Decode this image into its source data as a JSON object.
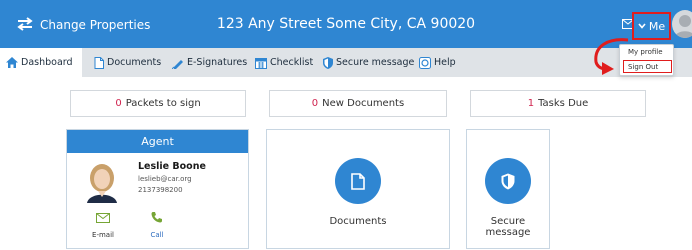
{
  "header": {
    "app_title": "Change Properties",
    "address": "123 Any Street Some City, CA 90020",
    "me_label": "Me"
  },
  "user_menu": {
    "items": [
      "My profile",
      "Sign Out"
    ]
  },
  "nav": {
    "tabs": [
      {
        "label": "Dashboard",
        "icon": "home-icon",
        "active": true
      },
      {
        "label": "Documents",
        "icon": "document-icon"
      },
      {
        "label": "E-Signatures",
        "icon": "pen-icon"
      },
      {
        "label": "Checklist",
        "icon": "calendar-icon"
      },
      {
        "label": "Secure message",
        "icon": "shield-icon"
      },
      {
        "label": "Help",
        "icon": "help-icon"
      }
    ]
  },
  "stats": [
    {
      "count": "0",
      "label": "Packets to sign"
    },
    {
      "count": "0",
      "label": "New Documents"
    },
    {
      "count": "1",
      "label": "Tasks Due"
    }
  ],
  "agent": {
    "header": "Agent",
    "name": "Leslie Boone",
    "email": "leslieb@car.org",
    "phone": "2137398200",
    "email_label": "E-mail",
    "call_label": "Call"
  },
  "tiles": {
    "documents": "Documents",
    "secure_message": "Secure message"
  },
  "colors": {
    "primary": "#2f86d2",
    "accent_red": "#e01d1d",
    "count_red": "#d0244f",
    "nav_bg": "#dfe3e7"
  }
}
